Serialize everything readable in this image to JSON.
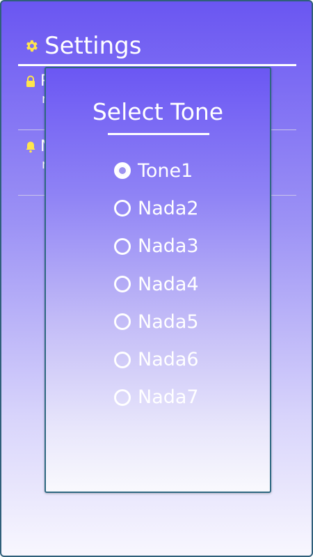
{
  "header": {
    "title": "Settings",
    "icon": "gear-icon",
    "icon_color": "#ffe54c"
  },
  "settings_rows": [
    {
      "icon": "lock-icon",
      "title": "P",
      "subtitle": "n"
    },
    {
      "icon": "bell-icon",
      "title": "N",
      "subtitle": "n"
    }
  ],
  "dialog": {
    "title": "Select Tone",
    "options": [
      {
        "label": "Tone1",
        "selected": true
      },
      {
        "label": "Nada2",
        "selected": false
      },
      {
        "label": "Nada3",
        "selected": false
      },
      {
        "label": "Nada4",
        "selected": false
      },
      {
        "label": "Nada5",
        "selected": false
      },
      {
        "label": "Nada6",
        "selected": false
      },
      {
        "label": "Nada7",
        "selected": false
      }
    ]
  },
  "colors": {
    "gradient_top": "#6a56f2",
    "gradient_bottom": "#f8f7fe",
    "icon_yellow": "#ffe54c",
    "border": "#2f5f7a"
  }
}
